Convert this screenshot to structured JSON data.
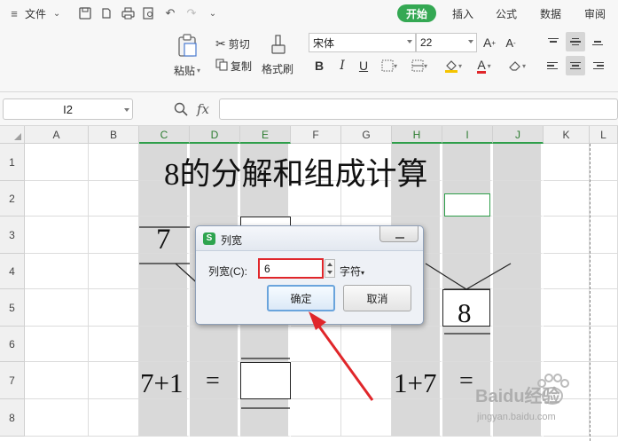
{
  "toolbar": {
    "file_label": "文件",
    "tabs": [
      "开始",
      "插入",
      "公式",
      "数据",
      "审阅"
    ],
    "paste_label": "粘贴",
    "cut_label": "剪切",
    "copy_label": "复制",
    "format_painter_label": "格式刷",
    "font_name": "宋体",
    "font_size": "22",
    "accent_color": "#34a853"
  },
  "formula_bar": {
    "name_box": "I2",
    "fx_label": "fx",
    "formula": ""
  },
  "grid": {
    "columns": [
      "A",
      "B",
      "C",
      "D",
      "E",
      "F",
      "G",
      "H",
      "I",
      "J",
      "K",
      "L"
    ],
    "selected_columns": [
      "C",
      "D",
      "E",
      "H",
      "I",
      "J"
    ],
    "rows": [
      "1",
      "2",
      "3",
      "4",
      "5",
      "6",
      "7",
      "8"
    ],
    "title": "8的分解和组成计算",
    "cell_c3": "7",
    "cell_i5": "8",
    "left_formula": "7+1",
    "left_equals": "=",
    "right_formula": "1+7",
    "right_equals": "="
  },
  "dialog": {
    "title": "列宽",
    "logo": "S",
    "field_label": "列宽(C):",
    "field_value": "6",
    "unit_label": "字符",
    "ok_label": "确定",
    "cancel_label": "取消",
    "highlight_color": "#e0262a"
  },
  "watermark": {
    "brand": "Baidu经验",
    "url": "jingyan.baidu.com"
  }
}
